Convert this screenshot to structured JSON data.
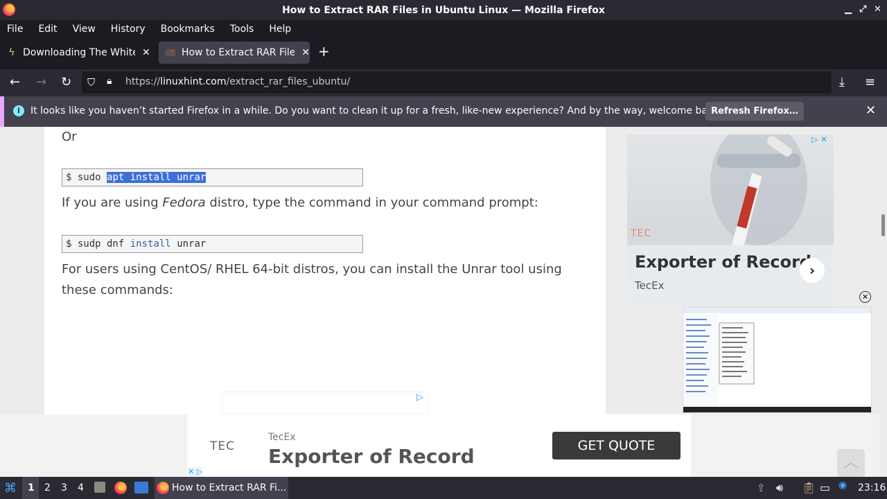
{
  "window": {
    "title": "How to Extract RAR Files in Ubuntu Linux — Mozilla Firefox"
  },
  "menu": [
    "File",
    "Edit",
    "View",
    "History",
    "Bookmarks",
    "Tools",
    "Help"
  ],
  "tabs": [
    {
      "label": "Downloading The White Lodge",
      "active": false
    },
    {
      "label": "How to Extract RAR Files in Ubuntu Linux",
      "active": true
    }
  ],
  "url": {
    "scheme": "https://",
    "domain": "linuxhint.com",
    "path": "/extract_rar_files_ubuntu/"
  },
  "notification": {
    "message": "It looks like you haven’t started Firefox in a while. Do you want to clean it up for a fresh, like-new experience? And by the way, welcome back!",
    "button": "Refresh Firefox…"
  },
  "article": {
    "or": "Or",
    "code1": {
      "prompt": "$ sudo",
      "selected": "apt install unrar"
    },
    "fedora_pre": "If you are using ",
    "fedora_em": "Fedora",
    "fedora_post": " distro, type the command in your command prompt:",
    "code2": {
      "prompt": "$ sudp dnf",
      "kw": "install",
      "rest": "unrar"
    },
    "centos_line1": "For users using CentOS/ RHEL 64-bit distros, you can install the Unrar tool using",
    "centos_line2": "these commands:"
  },
  "ad_right": {
    "logo": "TEC",
    "headline": "Exporter of Record",
    "brand": "TecEx"
  },
  "ad_bottom": {
    "logo": "TEC",
    "brand": "TecEx",
    "headline": "Exporter of Record",
    "cta": "GET QUOTE"
  },
  "taskbar": {
    "workspaces": [
      "1",
      "2",
      "3",
      "4"
    ],
    "window": "How to Extract RAR Fi...",
    "clock": "23:16"
  },
  "colors": {
    "chrome_dark": "#1c1b22",
    "chrome_mid": "#2b2a33",
    "selection": "#3d6fd9"
  }
}
